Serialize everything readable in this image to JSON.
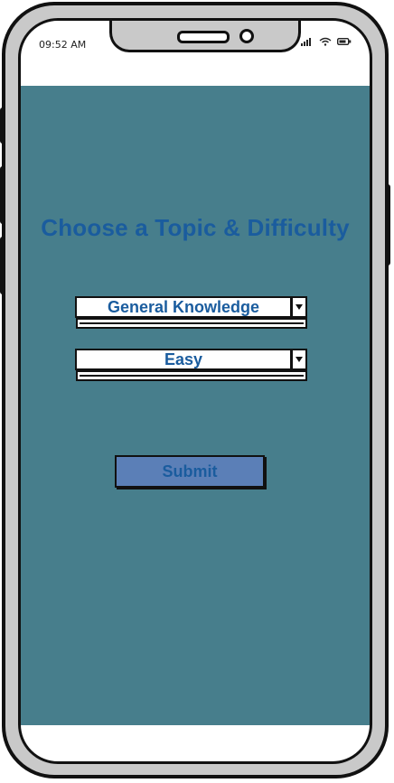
{
  "status_bar": {
    "time": "09:52 AM"
  },
  "main": {
    "title": "Choose a Topic & Difficulty",
    "topic_select": {
      "value": "General Knowledge"
    },
    "difficulty_select": {
      "value": "Easy"
    },
    "submit_label": "Submit"
  },
  "colors": {
    "screen_background": "#477e8c",
    "title_text": "#1a5c9e",
    "submit_button": "#5b7fb7",
    "phone_frame": "#c9c9c9"
  },
  "icons": [
    "signal-icon",
    "wifi-icon",
    "battery-icon",
    "dropdown-arrow-icon"
  ]
}
